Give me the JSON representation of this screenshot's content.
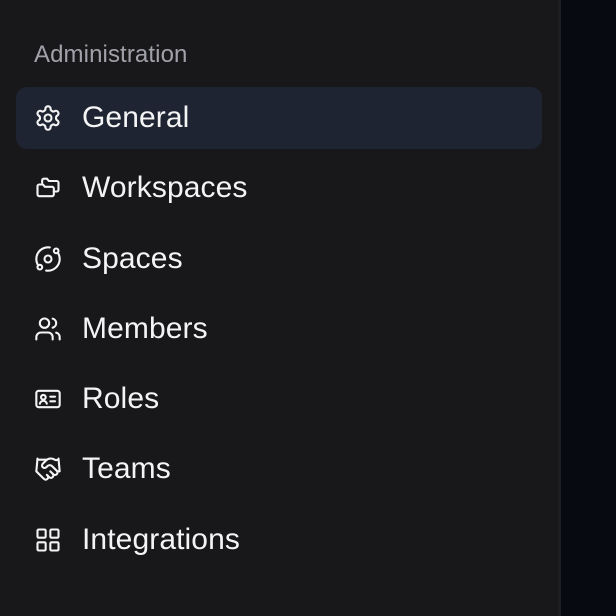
{
  "sidebar": {
    "section_title": "Administration",
    "items": [
      {
        "label": "General",
        "icon": "gear-icon",
        "active": true
      },
      {
        "label": "Workspaces",
        "icon": "workspaces-icon",
        "active": false
      },
      {
        "label": "Spaces",
        "icon": "orbit-icon",
        "active": false
      },
      {
        "label": "Members",
        "icon": "users-icon",
        "active": false
      },
      {
        "label": "Roles",
        "icon": "id-card-icon",
        "active": false
      },
      {
        "label": "Teams",
        "icon": "handshake-icon",
        "active": false
      },
      {
        "label": "Integrations",
        "icon": "grid-icon",
        "active": false
      }
    ]
  },
  "colors": {
    "sidebar_bg": "#18181b",
    "active_item_bg": "#1e2431",
    "text": "#f4f4f5",
    "muted_text": "#a1a1aa",
    "main_bg": "#080a11"
  }
}
